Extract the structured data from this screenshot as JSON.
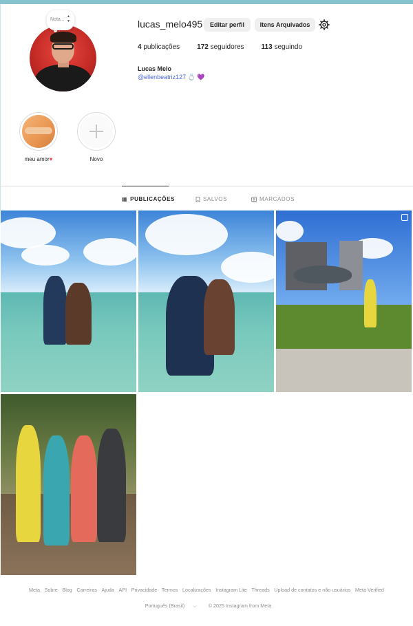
{
  "profile": {
    "username": "lucas_melo495",
    "full_name": "Lucas Melo",
    "bio_mention": "@ellenbeatriz127",
    "bio_emoji": "💍 💜",
    "note_placeholder": "Nota...",
    "edit_button": "Editar perfil",
    "archive_button": "Itens Arquivados",
    "stats": {
      "posts_count": "4",
      "posts_label": "publicações",
      "followers_count": "172",
      "followers_label": "seguidores",
      "following_count": "113",
      "following_label": "seguindo"
    }
  },
  "highlights": [
    {
      "label": "meu amor"
    },
    {
      "label": "Novo"
    }
  ],
  "tabs": [
    {
      "label": "PUBLICAÇÕES",
      "icon": "grid-icon",
      "active": true
    },
    {
      "label": "SALVOS",
      "icon": "bookmark-icon",
      "active": false
    },
    {
      "label": "MARCADOS",
      "icon": "tagged-icon",
      "active": false
    }
  ],
  "footer": {
    "links": [
      "Meta",
      "Sobre",
      "Blog",
      "Carreiras",
      "Ajuda",
      "API",
      "Privacidade",
      "Termos",
      "Localizações",
      "Instagram Lite",
      "Threads",
      "Upload de contatos e não usuários",
      "Meta Verified"
    ],
    "language": "Português (Brasil)",
    "copyright": "© 2025 Instagram from Meta"
  },
  "colors": {
    "accent_link": "#4b6ad6",
    "heart": "#ed4956",
    "button_bg": "#efefef",
    "top_bar": "#86c3cf"
  }
}
